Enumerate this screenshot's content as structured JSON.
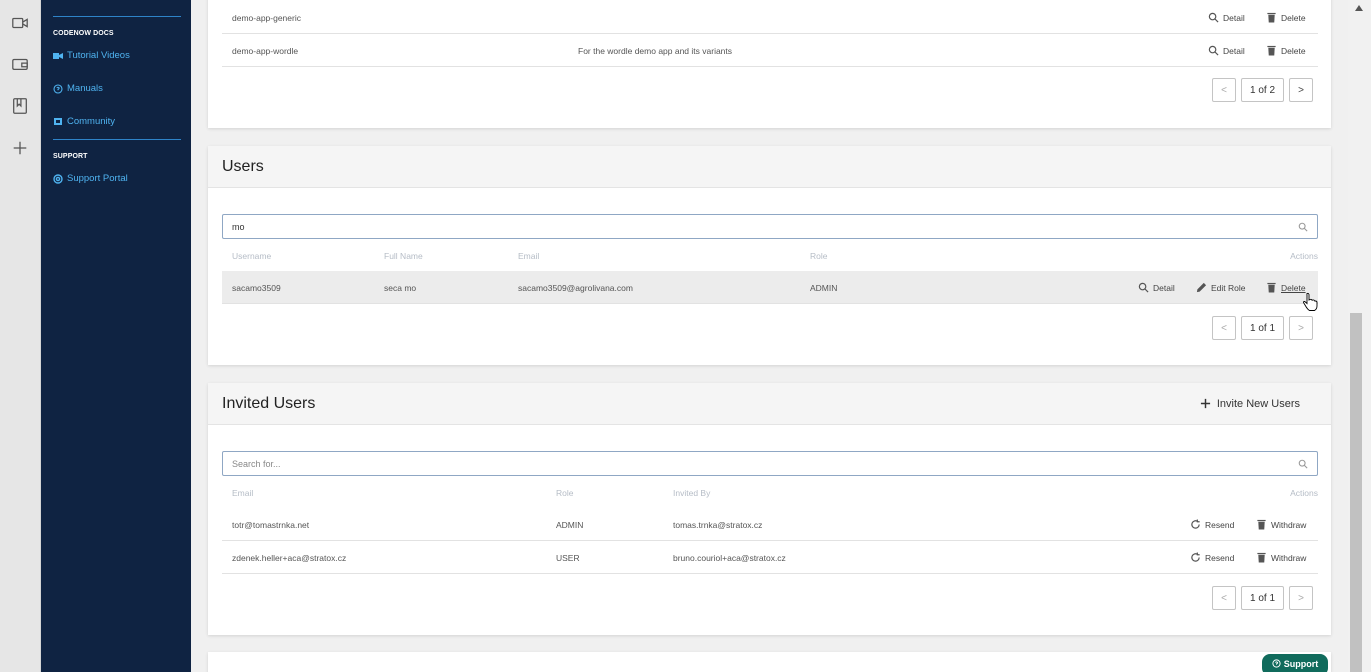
{
  "rail": {
    "icons": [
      "video-icon",
      "wallet-icon",
      "book-icon",
      "plus-icon"
    ]
  },
  "sidebar": {
    "docs_heading": "CODENOW DOCS",
    "docs_items": [
      {
        "label": "Tutorial Videos",
        "icon": "video-icon"
      },
      {
        "label": "Manuals",
        "icon": "help-circle-icon"
      },
      {
        "label": "Community",
        "icon": "chat-icon"
      }
    ],
    "support_heading": "SUPPORT",
    "support_items": [
      {
        "label": "Support Portal",
        "icon": "lifebuoy-icon"
      }
    ]
  },
  "applications": {
    "rows": [
      {
        "name": "demo-app-generic",
        "description": "",
        "detail": "Detail",
        "delete": "Delete"
      },
      {
        "name": "demo-app-wordle",
        "description": "For the wordle demo app and its variants",
        "detail": "Detail",
        "delete": "Delete"
      }
    ],
    "pager": {
      "prev": "<",
      "count": "1 of 2",
      "next": ">"
    }
  },
  "users": {
    "title": "Users",
    "search_value": "mo",
    "columns": {
      "username": "Username",
      "full_name": "Full Name",
      "email": "Email",
      "role": "Role",
      "actions": "Actions"
    },
    "rows": [
      {
        "username": "sacamo3509",
        "full_name": "seca mo",
        "email": "sacamo3509@agrolivana.com",
        "role": "ADMIN",
        "detail": "Detail",
        "edit_role": "Edit Role",
        "delete": "Delete"
      }
    ],
    "pager": {
      "prev": "<",
      "count": "1 of 1",
      "next": ">"
    }
  },
  "invited_users": {
    "title": "Invited Users",
    "invite_button": "Invite New Users",
    "search_placeholder": "Search for...",
    "columns": {
      "email": "Email",
      "role": "Role",
      "invited_by": "Invited By",
      "actions": "Actions"
    },
    "rows": [
      {
        "email": "totr@tomastrnka.net",
        "role": "ADMIN",
        "invited_by": "tomas.trnka@stratox.cz",
        "resend": "Resend",
        "withdraw": "Withdraw"
      },
      {
        "email": "zdenek.heller+aca@stratox.cz",
        "role": "USER",
        "invited_by": "bruno.couriol+aca@stratox.cz",
        "resend": "Resend",
        "withdraw": "Withdraw"
      }
    ],
    "pager": {
      "prev": "<",
      "count": "1 of 1",
      "next": ">"
    }
  },
  "support_button": "Support",
  "colors": {
    "sidebar": "#0f2342",
    "link": "#4fb3f0",
    "support": "#106b5c"
  }
}
